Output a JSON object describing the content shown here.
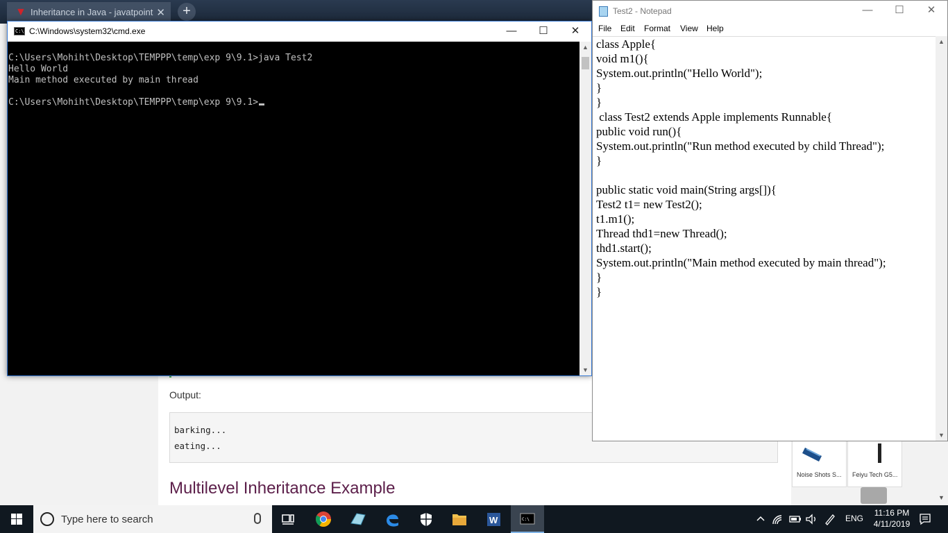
{
  "browser": {
    "tab_title": "Inheritance in Java - javatpoint",
    "tab_close": "✕",
    "new_tab": "+",
    "page": {
      "output_label": "Output:",
      "output_lines": [
        "barking...",
        "eating..."
      ],
      "heading": "Multilevel Inheritance Example",
      "ads": [
        {
          "label": "Noise Shots S..."
        },
        {
          "label": "Feiyu Tech G5..."
        }
      ]
    }
  },
  "cmd": {
    "title": "C:\\Windows\\system32\\cmd.exe",
    "icon_text": "C:\\",
    "controls": {
      "minimize": "—",
      "maximize": "☐",
      "close": "✕"
    },
    "lines": [
      "",
      "C:\\Users\\Mohiht\\Desktop\\TEMPPP\\temp\\exp 9\\9.1>java Test2",
      "Hello World",
      "Main method executed by main thread",
      "",
      "C:\\Users\\Mohiht\\Desktop\\TEMPPP\\temp\\exp 9\\9.1>"
    ]
  },
  "notepad": {
    "title": "Test2 - Notepad",
    "controls": {
      "minimize": "—",
      "maximize": "☐",
      "close": "✕"
    },
    "menu": [
      "File",
      "Edit",
      "Format",
      "View",
      "Help"
    ],
    "lines": [
      "class Apple{",
      "void m1(){",
      "System.out.println(\"Hello World\");",
      "}",
      "}",
      " class Test2 extends Apple implements Runnable{",
      "public void run(){",
      "System.out.println(\"Run method executed by child Thread\");",
      "}",
      "",
      "public static void main(String args[]){",
      "Test2 t1= new Test2();",
      "t1.m1();",
      "Thread thd1=new Thread();",
      "thd1.start();",
      "System.out.println(\"Main method executed by main thread\");",
      "}",
      "}"
    ]
  },
  "taskbar": {
    "search_placeholder": "Type here to search",
    "apps": [
      "task-view",
      "chrome",
      "app",
      "edge",
      "security",
      "file-explorer",
      "word",
      "cmd"
    ],
    "language": "ENG",
    "time": "11:16 PM",
    "date": "4/11/2019"
  },
  "colors": {
    "heading": "#5c1f4a",
    "taskbar": "#101820",
    "cmd_text": "#c0c0c0"
  }
}
